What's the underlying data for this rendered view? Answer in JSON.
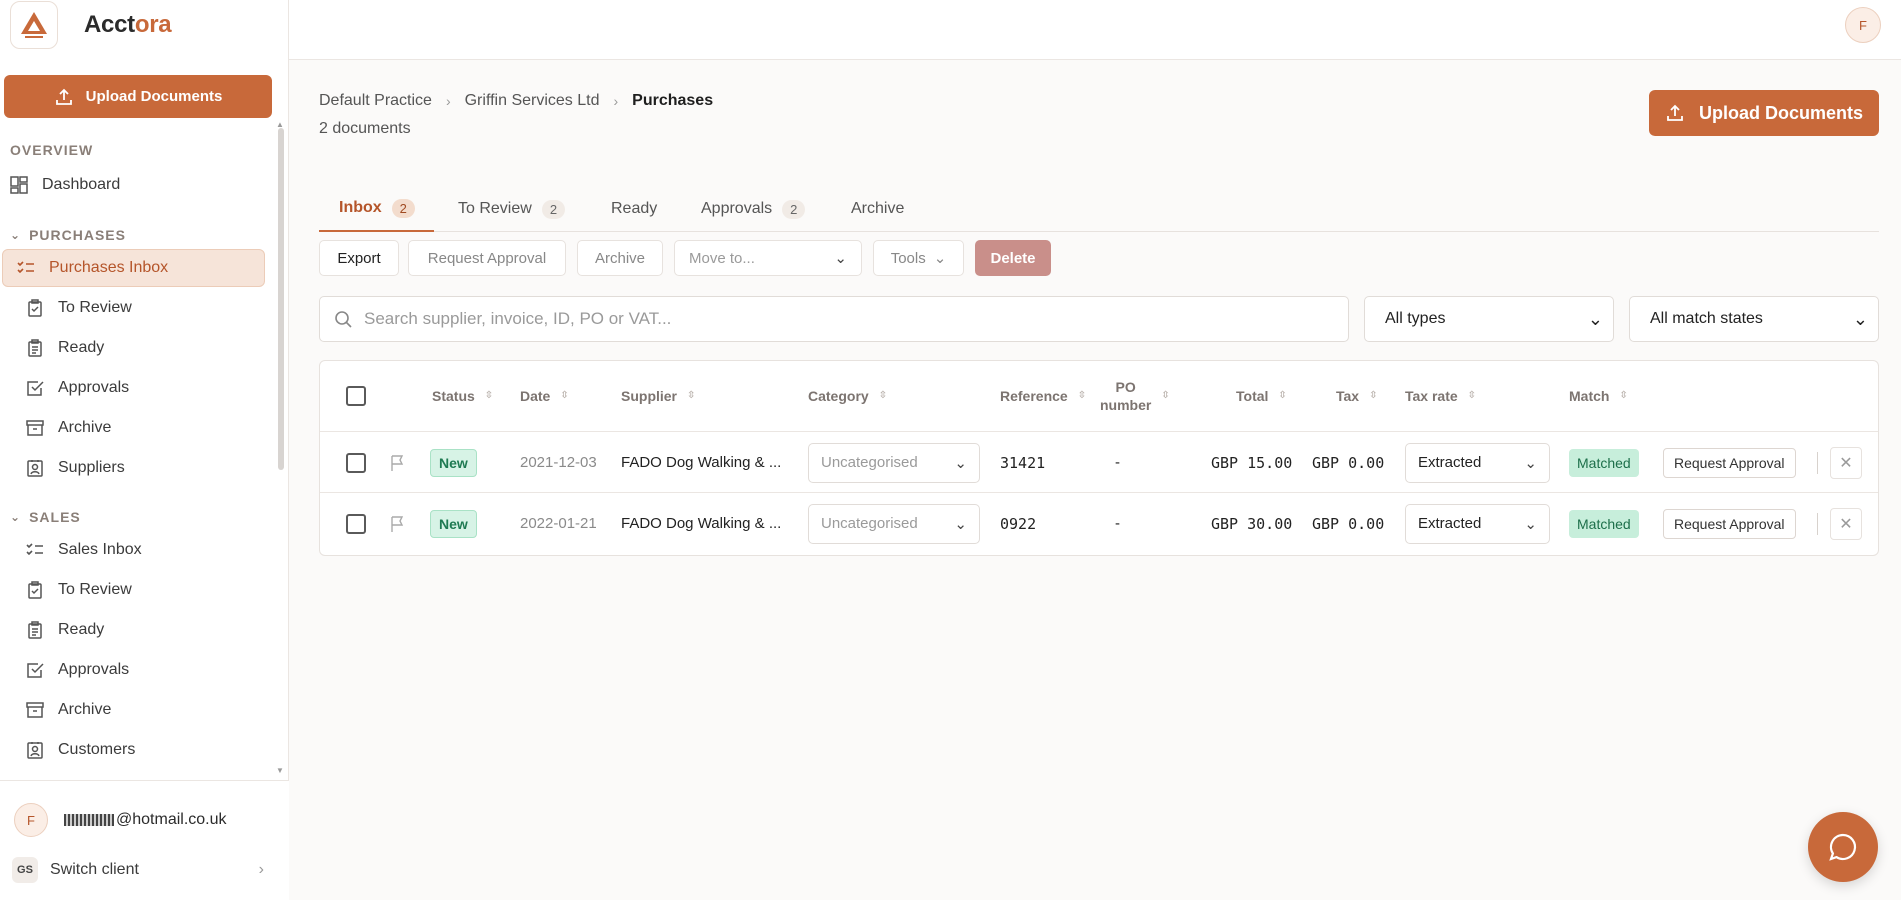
{
  "brand": {
    "name_prefix": "Acct",
    "name_accent": "ora",
    "logo_icon": "a-logo-icon"
  },
  "sidebar": {
    "upload_label": "Upload Documents",
    "overview_title": "OVERVIEW",
    "dashboard_label": "Dashboard",
    "purchases_title": "PURCHASES",
    "purchases_items": [
      {
        "label": "Purchases Inbox",
        "icon": "checklist-icon",
        "active": true
      },
      {
        "label": "To Review",
        "icon": "clipboard-check-icon"
      },
      {
        "label": "Ready",
        "icon": "clipboard-list-icon"
      },
      {
        "label": "Approvals",
        "icon": "check-square-icon"
      },
      {
        "label": "Archive",
        "icon": "archive-icon"
      },
      {
        "label": "Suppliers",
        "icon": "contact-icon"
      }
    ],
    "sales_title": "SALES",
    "sales_items": [
      {
        "label": "Sales Inbox",
        "icon": "checklist-icon"
      },
      {
        "label": "To Review",
        "icon": "clipboard-check-icon"
      },
      {
        "label": "Ready",
        "icon": "clipboard-list-icon"
      },
      {
        "label": "Approvals",
        "icon": "check-square-icon"
      },
      {
        "label": "Archive",
        "icon": "archive-icon"
      },
      {
        "label": "Customers",
        "icon": "contact-icon"
      }
    ],
    "user": {
      "initial": "F",
      "email": "@hotmail.co.uk"
    },
    "switch": {
      "badge": "GS",
      "label": "Switch client"
    }
  },
  "topbar": {
    "avatar_initial": "F"
  },
  "breadcrumb": [
    "Default Practice",
    "Griffin Services Ltd",
    "Purchases"
  ],
  "doc_count": "2 documents",
  "upload_label": "Upload Documents",
  "tabs": [
    {
      "label": "Inbox",
      "count": "2",
      "active": true
    },
    {
      "label": "To Review",
      "count": "2"
    },
    {
      "label": "Ready",
      "count": ""
    },
    {
      "label": "Approvals",
      "count": "2"
    },
    {
      "label": "Archive",
      "count": ""
    }
  ],
  "toolbar": {
    "export": "Export",
    "request_approval": "Request Approval",
    "archive": "Archive",
    "move_to": "Move to...",
    "tools": "Tools",
    "delete": "Delete"
  },
  "search": {
    "placeholder": "Search supplier, invoice, ID, PO or VAT..."
  },
  "filters": {
    "types": "All types",
    "match_states": "All match states"
  },
  "table": {
    "headers": {
      "status": "Status",
      "date": "Date",
      "supplier": "Supplier",
      "category": "Category",
      "reference": "Reference",
      "po_line1": "PO",
      "po_line2": "number",
      "total": "Total",
      "tax": "Tax",
      "tax_rate": "Tax rate",
      "match": "Match"
    },
    "rows": [
      {
        "status": "New",
        "date": "2021-12-03",
        "supplier": "FADO Dog Walking & ...",
        "category": "Uncategorised",
        "reference": "31421",
        "po": "-",
        "total": "GBP 15.00",
        "tax": "GBP 0.00",
        "tax_rate": "Extracted",
        "match": "Matched",
        "action": "Request Approval"
      },
      {
        "status": "New",
        "date": "2022-01-21",
        "supplier": "FADO Dog Walking & ...",
        "category": "Uncategorised",
        "reference": "0922",
        "po": "-",
        "total": "GBP 30.00",
        "tax": "GBP 0.00",
        "tax_rate": "Extracted",
        "match": "Matched",
        "action": "Request Approval"
      }
    ]
  },
  "colors": {
    "accent": "#c8693a",
    "delete": "#c98f8a",
    "matched_bg": "#c7eedb",
    "new_bg": "#d7f3e6"
  }
}
